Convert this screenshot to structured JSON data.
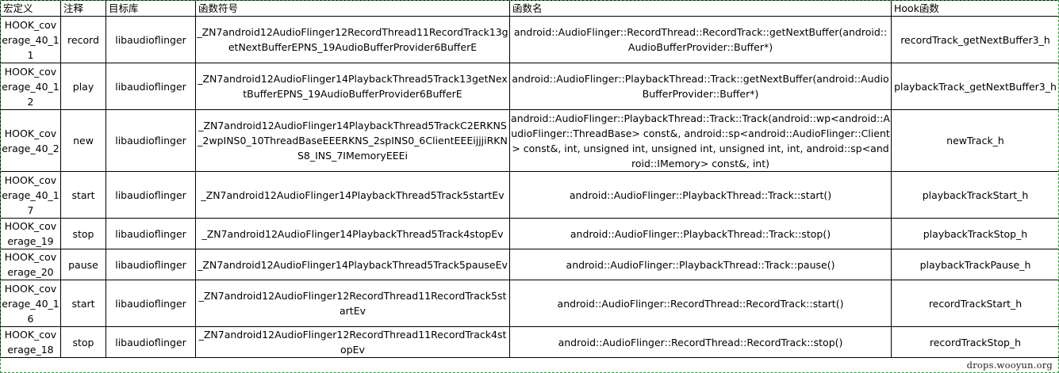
{
  "headers": {
    "macro": "宏定义",
    "note": "注释",
    "lib": "目标库",
    "symbol": "函数符号",
    "func": "函数名",
    "hook": "Hook函数"
  },
  "rows": [
    {
      "macro": "HOOK_coverage_40_11",
      "note": "record",
      "lib": "libaudioflinger",
      "symbol": "_ZN7android12AudioFlinger12RecordThread11RecordTrack13getNextBufferEPNS_19AudioBufferProvider6BufferE",
      "func": "android::AudioFlinger::RecordThread::RecordTrack::getNextBuffer(android::AudioBufferProvider::Buffer*)",
      "hook": "recordTrack_getNextBuffer3_h"
    },
    {
      "macro": "HOOK_coverage_40_12",
      "note": "play",
      "lib": "libaudioflinger",
      "symbol": "_ZN7android12AudioFlinger14PlaybackThread5Track13getNextBufferEPNS_19AudioBufferProvider6BufferE",
      "func": "android::AudioFlinger::PlaybackThread::Track::getNextBuffer(android::AudioBufferProvider::Buffer*)",
      "hook": "playbackTrack_getNextBuffer3_h"
    },
    {
      "macro": "HOOK_coverage_40_2",
      "note": "new",
      "lib": "libaudioflinger",
      "symbol": "_ZN7android12AudioFlinger14PlaybackThread5TrackC2ERKNS_2wpINS0_10ThreadBaseEEERKNS_2spINS0_6ClientEEEijjjiRKNS8_INS_7IMemoryEEEi",
      "func": "android::AudioFlinger::PlaybackThread::Track::Track(android::wp<android::AudioFlinger::ThreadBase> const&, android::sp<android::AudioFlinger::Client> const&, int, unsigned int, unsigned int, unsigned int, int, android::sp<android::IMemory> const&, int)",
      "hook": "newTrack_h"
    },
    {
      "macro": "HOOK_coverage_40_17",
      "note": "start",
      "lib": "libaudioflinger",
      "symbol": "_ZN7android12AudioFlinger14PlaybackThread5Track5startEv",
      "func": "android::AudioFlinger::PlaybackThread::Track::start()",
      "hook": "playbackTrackStart_h"
    },
    {
      "macro": "HOOK_coverage_19",
      "note": "stop",
      "lib": "libaudioflinger",
      "symbol": "_ZN7android12AudioFlinger14PlaybackThread5Track4stopEv",
      "func": "android::AudioFlinger::PlaybackThread::Track::stop()",
      "hook": "playbackTrackStop_h"
    },
    {
      "macro": "HOOK_coverage_20",
      "note": "pause",
      "lib": "libaudioflinger",
      "symbol": "_ZN7android12AudioFlinger14PlaybackThread5Track5pauseEv",
      "func": "android::AudioFlinger::PlaybackThread::Track::pause()",
      "hook": "playbackTrackPause_h"
    },
    {
      "macro": "HOOK_coverage_40_16",
      "note": "start",
      "lib": "libaudioflinger",
      "symbol": "_ZN7android12AudioFlinger12RecordThread11RecordTrack5startEv",
      "func": "android::AudioFlinger::RecordThread::RecordTrack::start()",
      "hook": "recordTrackStart_h"
    },
    {
      "macro": "HOOK_coverage_18",
      "note": "stop",
      "lib": "libaudioflinger",
      "symbol": "_ZN7android12AudioFlinger12RecordThread11RecordTrack4stopEv",
      "func": "android::AudioFlinger::RecordThread::RecordTrack::stop()",
      "hook": "recordTrackStop_h"
    }
  ],
  "watermark": "drops.wooyun.org"
}
